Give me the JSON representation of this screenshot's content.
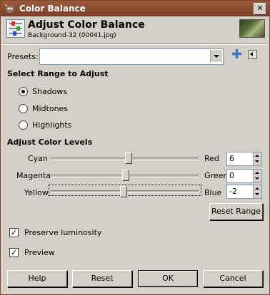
{
  "window": {
    "title": "Color Balance"
  },
  "header": {
    "title": "Adjust Color Balance",
    "subtitle": "Background-32 (00041.jpg)"
  },
  "presets": {
    "label": "Presets:",
    "value": ""
  },
  "range": {
    "heading": "Select Range to Adjust",
    "options": [
      "Shadows",
      "Midtones",
      "Highlights"
    ],
    "selected": "Shadows"
  },
  "levels": {
    "heading": "Adjust Color Levels",
    "rows": [
      {
        "left": "Cyan",
        "right": "Red",
        "value": "6"
      },
      {
        "left": "Magenta",
        "right": "Green",
        "value": "0"
      },
      {
        "left": "Yellow",
        "right": "Blue",
        "value": "-2"
      }
    ],
    "reset_label": "Reset Range"
  },
  "options": {
    "preserve_label": "Preserve luminosity",
    "preserve_checked": true,
    "preview_label": "Preview",
    "preview_checked": true
  },
  "buttons": {
    "help": "Help",
    "reset": "Reset",
    "ok": "OK",
    "cancel": "Cancel"
  }
}
